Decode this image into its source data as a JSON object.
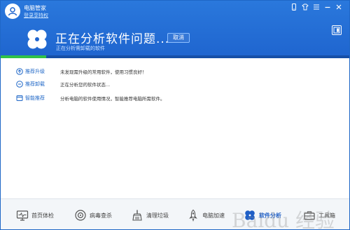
{
  "header": {
    "app_name": "电脑管家",
    "login_link": "登录享特权",
    "main_title": "正在分析软件问题...",
    "sub_title": "正在分析需卸载的软件",
    "cancel_label": "取消",
    "progress": 0.13,
    "colors": {
      "header": "#1f65cf",
      "progress": "#30c247"
    }
  },
  "content": {
    "rows": [
      {
        "label": "推荐升级",
        "desc": "未发现需升级的常用软件，使用习惯良好！",
        "icon": "upgrade-icon"
      },
      {
        "label": "推荐卸载",
        "desc": "正在分析您的软件状态...",
        "icon": "uninstall-icon"
      },
      {
        "label": "智能推荐",
        "desc": "分析电脑的软件使用情况，智能推荐电脑所需软件。",
        "icon": "recommend-icon"
      }
    ]
  },
  "nav": {
    "items": [
      {
        "label": "首页体检",
        "icon": "monitor-icon"
      },
      {
        "label": "病毒查杀",
        "icon": "virus-scan-icon"
      },
      {
        "label": "清理垃圾",
        "icon": "broom-icon"
      },
      {
        "label": "电脑加速",
        "icon": "rocket-icon"
      },
      {
        "label": "软件分析",
        "icon": "clover-icon",
        "active": true
      },
      {
        "label": "工具箱",
        "icon": "toolbox-icon"
      }
    ]
  },
  "watermark": "Baidu 经验"
}
